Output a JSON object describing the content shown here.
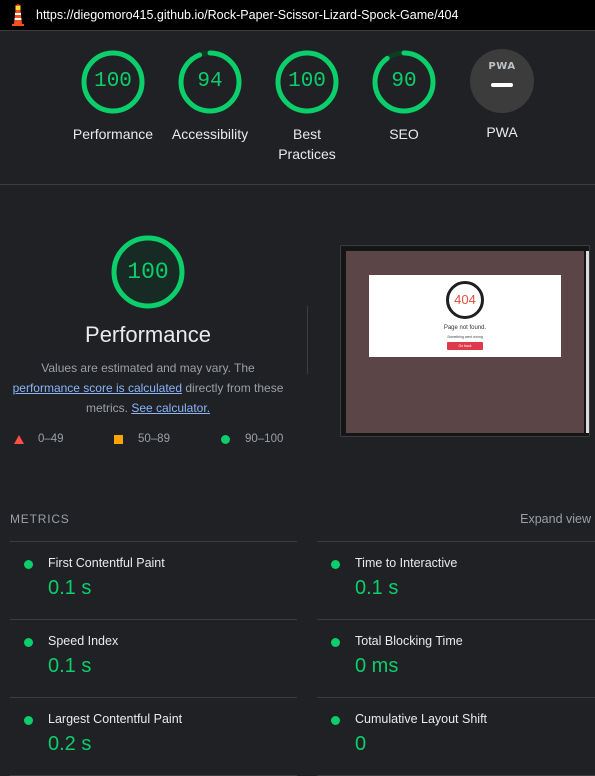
{
  "browser": {
    "url": "https://diegomoro415.github.io/Rock-Paper-Scissor-Lizard-Spock-Game/404",
    "logo_icon": "lighthouse-icon"
  },
  "colors": {
    "pass": "#0cce6b",
    "average": "#ffa400",
    "fail": "#ff4e42",
    "background": "#202124"
  },
  "categories": [
    {
      "label": "Performance",
      "score": "100",
      "score_value": 100
    },
    {
      "label": "Accessibility",
      "score": "94",
      "score_value": 94
    },
    {
      "label": "Best Practices",
      "score": "100",
      "score_value": 100
    },
    {
      "label": "SEO",
      "score": "90",
      "score_value": 90
    }
  ],
  "pwa": {
    "label": "PWA",
    "badge_text": "PWA"
  },
  "performance": {
    "score": "100",
    "score_value": 100,
    "title": "Performance",
    "desc_prefix": "Values are estimated and may vary. The ",
    "desc_link": "performance score is calculated",
    "desc_mid": " directly from these metrics. ",
    "desc_link2": "See calculator."
  },
  "legend": [
    {
      "range": "0–49",
      "icon": "triangle-icon"
    },
    {
      "range": "50–89",
      "icon": "square-icon"
    },
    {
      "range": "90–100",
      "icon": "circle-icon"
    }
  ],
  "screenshot": {
    "error_code": "404",
    "message": "Page not found.",
    "submessage": "Something went wrong",
    "button": "Go back"
  },
  "metrics": {
    "heading": "METRICS",
    "expand_label": "Expand view",
    "items": [
      {
        "label": "First Contentful Paint",
        "value": "0.1 s"
      },
      {
        "label": "Time to Interactive",
        "value": "0.1 s"
      },
      {
        "label": "Speed Index",
        "value": "0.1 s"
      },
      {
        "label": "Total Blocking Time",
        "value": "0 ms"
      },
      {
        "label": "Largest Contentful Paint",
        "value": "0.2 s"
      },
      {
        "label": "Cumulative Layout Shift",
        "value": "0"
      }
    ]
  }
}
